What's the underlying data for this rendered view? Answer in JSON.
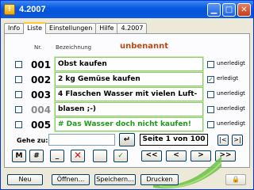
{
  "window": {
    "title": "4.2007",
    "app_icon": "app-icon",
    "accent": "#0a5ae0"
  },
  "tabs": [
    {
      "label": "Info",
      "active": false
    },
    {
      "label": "Liste",
      "active": true
    },
    {
      "label": "Einstellungen",
      "active": false
    },
    {
      "label": "Hilfe",
      "active": false
    },
    {
      "label": "4.2007",
      "active": false
    }
  ],
  "list": {
    "col_nr": "Nr.",
    "col_bezeichnung": "Bezeichnung",
    "name": "unbenannt",
    "done_label": "unerledigt",
    "done_label_checked": "erledigt",
    "rows": [
      {
        "nr": "001",
        "text": "Obst kaufen",
        "done": false,
        "status": "unerledigt"
      },
      {
        "nr": "002",
        "text": "2 kg Gemüse kaufen",
        "done": true,
        "status": "erledigt"
      },
      {
        "nr": "003",
        "text": "4 Flaschen Wasser mit vielen Luft-",
        "done": false,
        "status": "unerledigt"
      },
      {
        "nr": "004",
        "text": "blasen ;-)",
        "done": false,
        "status": "unerledigt"
      },
      {
        "nr": "005",
        "text": "# Das Wasser doch nicht kaufen!",
        "done": false,
        "status": "unerledigt"
      }
    ]
  },
  "goto": {
    "label": "Gehe zu:",
    "value": "",
    "enter_symbol": "↵"
  },
  "pagination": {
    "text": "Seite 1 von 100",
    "first": "|<",
    "last": ">|",
    "prev_fast": "<<",
    "prev": "<",
    "next": ">",
    "next_fast": ">>"
  },
  "tools": {
    "m": "M",
    "hash": "#",
    "underscore": "_",
    "delete": "✕",
    "empty": "",
    "check": "✓"
  },
  "bottom": {
    "new": "Neu",
    "open": "Öffnen...",
    "save": "Speichern...",
    "print": "Drucken"
  }
}
